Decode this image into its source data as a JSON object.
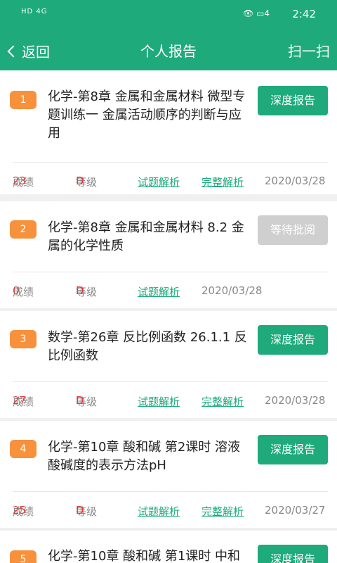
{
  "status_bar": {
    "left": "HD 4G",
    "time": "2:42",
    "battery": "4"
  },
  "header": {
    "back_label": "返回",
    "title": "个人报告",
    "scan_label": "扫一扫"
  },
  "labels": {
    "score": "成绩",
    "grade": "等级",
    "question_analysis": "试题解析",
    "full_analysis": "完整解析"
  },
  "reports": [
    {
      "index": "1",
      "title": "化学-第8章 金属和金属材料 微型专题训练一 金属活动顺序的判断与应用",
      "button": "深度报告",
      "score": "23",
      "grade": "D",
      "date": "2020/03/28",
      "has_full": true
    },
    {
      "index": "2",
      "title": "化学-第8章 金属和金属材料 8.2 金属的化学性质",
      "button": "等待批阅",
      "score": "0",
      "grade": "D",
      "date": "2020/03/28",
      "has_full": false
    },
    {
      "index": "3",
      "title": "数学-第26章 反比例函数 26.1.1 反比例函数",
      "button": "深度报告",
      "score": "27",
      "grade": "D",
      "date": "2020/03/28",
      "has_full": true
    },
    {
      "index": "4",
      "title": "化学-第10章 酸和碱 第2课时 溶液酸碱度的表示方法pH",
      "button": "深度报告",
      "score": "25",
      "grade": "D",
      "date": "2020/03/27",
      "has_full": true
    },
    {
      "index": "5",
      "title": "化学-第10章 酸和碱 第1课时 中和",
      "button": "深度报告"
    }
  ]
}
